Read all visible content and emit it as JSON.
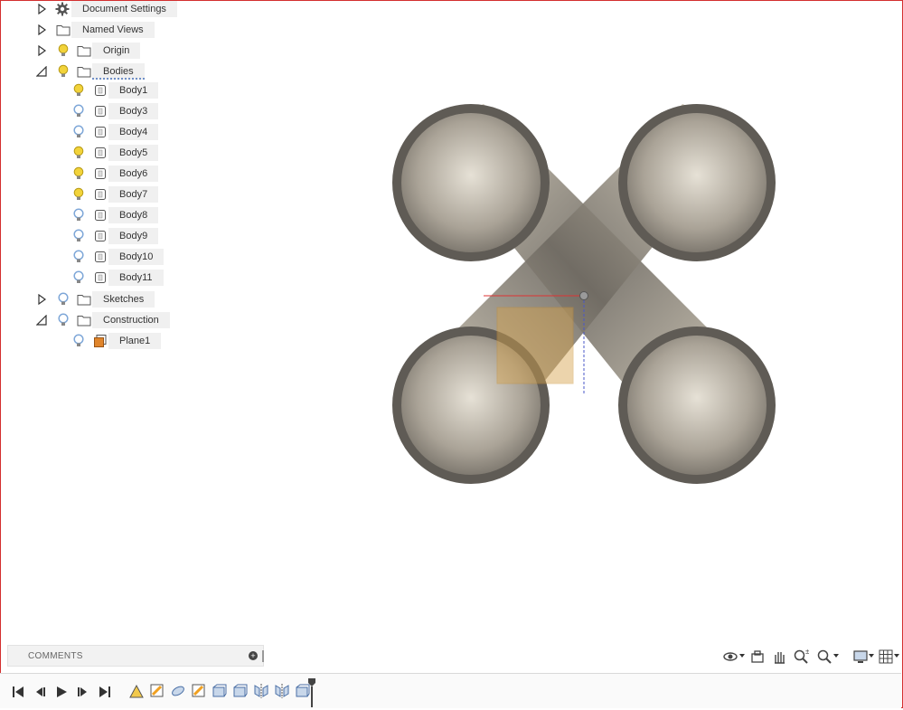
{
  "browser": {
    "items": [
      {
        "label": "Document Settings",
        "kind": "settings",
        "expander": "collapsed"
      },
      {
        "label": "Named Views",
        "kind": "folder",
        "expander": "collapsed"
      },
      {
        "label": "Origin",
        "kind": "folder",
        "expander": "collapsed",
        "bulb": "on"
      },
      {
        "label": "Bodies",
        "kind": "folder",
        "expander": "expanded",
        "bulb": "on"
      },
      {
        "label": "Sketches",
        "kind": "folder",
        "expander": "collapsed",
        "bulb": "off"
      },
      {
        "label": "Construction",
        "kind": "folder",
        "expander": "expanded",
        "bulb": "off"
      }
    ],
    "bodies": [
      {
        "label": "Body1",
        "visible": true
      },
      {
        "label": "Body3",
        "visible": false
      },
      {
        "label": "Body4",
        "visible": false
      },
      {
        "label": "Body5",
        "visible": true
      },
      {
        "label": "Body6",
        "visible": true
      },
      {
        "label": "Body7",
        "visible": true
      },
      {
        "label": "Body8",
        "visible": false
      },
      {
        "label": "Body9",
        "visible": false
      },
      {
        "label": "Body10",
        "visible": false
      },
      {
        "label": "Body11",
        "visible": false
      }
    ],
    "construction": [
      {
        "label": "Plane1",
        "visible": false
      }
    ]
  },
  "comments": {
    "label": "COMMENTS"
  },
  "colors": {
    "bulb_on": "#f2d33a",
    "bulb_off": "#7ea7d8",
    "plane": "#e0852b",
    "frame": "#d32f2f",
    "tube_rim": "#5f5b55",
    "tube_body": "#c9c1b0"
  },
  "nav_icons": [
    "orbit-icon",
    "look-at-icon",
    "pan-icon",
    "zoom-icon",
    "fit-icon",
    "display-settings-icon",
    "grid-settings-icon"
  ],
  "playback_icons": [
    "go-to-start-icon",
    "step-back-icon",
    "play-icon",
    "step-forward-icon",
    "go-to-end-icon"
  ],
  "timeline_features": [
    "sketch-feature-icon",
    "sketch-feature-icon",
    "extrude-feature-icon",
    "sketch-feature-icon",
    "extrude-feature-icon",
    "extrude-feature-icon",
    "mirror-feature-icon",
    "mirror-feature-icon",
    "extrude-feature-icon"
  ]
}
